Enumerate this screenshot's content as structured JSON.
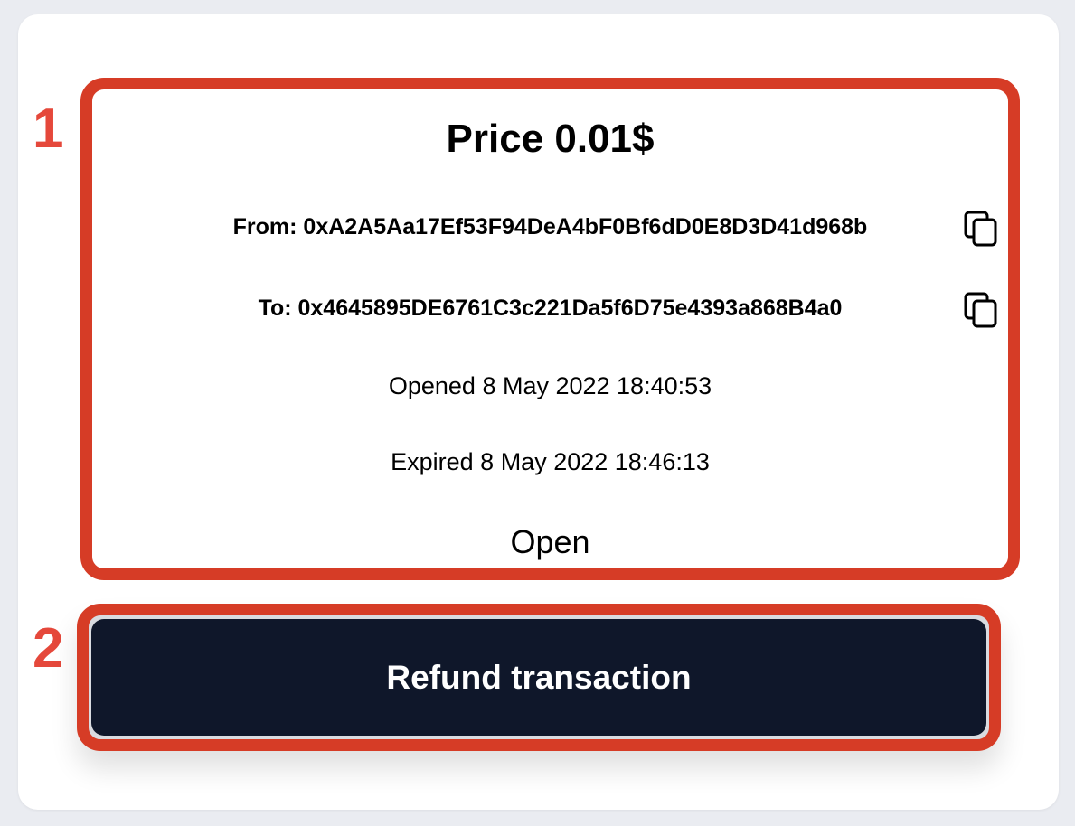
{
  "markers": {
    "first": "1",
    "second": "2"
  },
  "transaction": {
    "price": "Price 0.01$",
    "from": "From: 0xA2A5Aa17Ef53F94DeA4bF0Bf6dD0E8D3D41d968b",
    "to": "To: 0x4645895DE6761C3c221Da5f6D75e4393a868B4a0",
    "opened": "Opened 8 May 2022 18:40:53",
    "expired": "Expired 8 May 2022 18:46:13",
    "status": "Open",
    "icons": {
      "copy_from": "copy-icon",
      "copy_to": "copy-icon"
    }
  },
  "actions": {
    "refund_label": "Refund transaction"
  },
  "colors": {
    "highlight": "#d63c26",
    "marker_text": "#e5483b",
    "button_bg": "#0f172a",
    "button_text": "#ffffff"
  }
}
